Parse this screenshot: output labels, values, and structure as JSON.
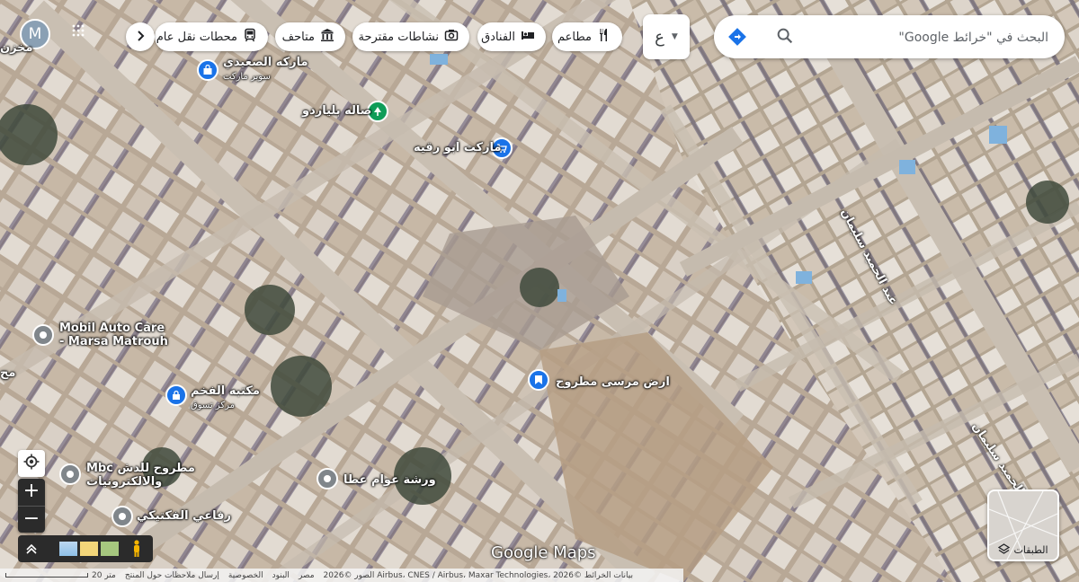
{
  "search": {
    "placeholder": "البحث في \"خرائط Google\""
  },
  "lang_selector": "ع",
  "avatar": "M",
  "categories": [
    {
      "label": "مطاعم",
      "icon": "restaurant-icon"
    },
    {
      "label": "الفنادق",
      "icon": "hotel-icon"
    },
    {
      "label": "نشاطات مقترحة",
      "icon": "camera-icon"
    },
    {
      "label": "متاحف",
      "icon": "museum-icon"
    },
    {
      "label": "محطات نقل عام",
      "icon": "transit-icon"
    }
  ],
  "places": [
    {
      "name": "ماركه الصعيدي",
      "sub": "سوبر ماركت",
      "icon": "shopping-bag-icon",
      "color": "#1a73e8"
    },
    {
      "name": "صاله بلياردو",
      "sub": "",
      "icon": "tree-icon",
      "color": "#0f9d58"
    },
    {
      "name": "ماركت ابو رقيه",
      "sub": "",
      "icon": "cart-icon",
      "color": "#1a73e8"
    },
    {
      "name": "Mobil Auto Care",
      "sub": "- Marsa Matrouh",
      "icon": "pin-icon",
      "color": "#80868b"
    },
    {
      "name": "مكتبه الفخم",
      "sub": "مركز تسوق",
      "icon": "lock-bag-icon",
      "color": "#1a73e8"
    },
    {
      "name": "ارض مرسى مطروح",
      "sub": "",
      "icon": "bookmark-icon",
      "color": "#1a73e8"
    },
    {
      "name": "Mbc مطروح للدش",
      "sub": "والالكترونيات",
      "icon": "pin-icon",
      "color": "#80868b"
    },
    {
      "name": "ورشة عوام عطا",
      "sub": "",
      "icon": "pin-icon",
      "color": "#80868b"
    },
    {
      "name": "رفاعي الفكتيكي",
      "sub": "",
      "icon": "pin-icon",
      "color": "#80868b"
    }
  ],
  "streets": [
    "عبد الحميد سليمان",
    "عبد الحميد سليمان"
  ],
  "edge_labels": [
    "مخزن",
    "مح"
  ],
  "layers_label": "الطبقات",
  "watermark": "Google Maps",
  "footer": {
    "scale": "20 متر",
    "links": [
      "إرسال ملاحظات حول المنتج",
      "الخصوصية",
      "البنود",
      "مصر"
    ],
    "attribution": "الصور ©2026 Airbus، CNES / Airbus، Maxar Technologies، بيانات الخرائط ©2026"
  }
}
